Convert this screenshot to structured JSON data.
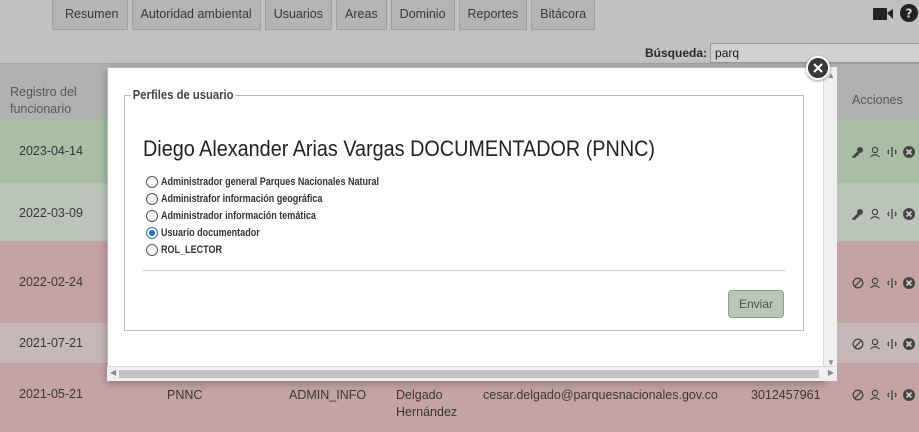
{
  "nav": {
    "tabs": [
      "Resumen",
      "Autoridad ambiental",
      "Usuarios",
      "Areas",
      "Dominio",
      "Reportes",
      "Bitácora"
    ]
  },
  "search": {
    "label": "Búsqueda:",
    "value": "parq"
  },
  "table": {
    "header_left": "Registro del funcionario",
    "header_right": "Acciones",
    "rows": [
      {
        "date": "2023-04-14"
      },
      {
        "date": "2022-03-09"
      },
      {
        "date": "2022-02-24"
      },
      {
        "date": "2021-07-21"
      },
      {
        "date": "2021-05-21",
        "entity": "PNNC",
        "role": "ADMIN_INFO",
        "surname": "Delgado Hernández",
        "email": "cesar.delgado@parquesnacionales.gov.co",
        "phone": "3012457961"
      }
    ]
  },
  "modal": {
    "legend": "Perfiles de usuario",
    "user_name": "Diego Alexander Arias Vargas DOCUMENTADOR (PNNC)",
    "roles": [
      {
        "label": "Administrador general Parques Nacionales Natural",
        "checked": false
      },
      {
        "label": "Administrafor información geográfica",
        "checked": false
      },
      {
        "label": "Administrador información temática",
        "checked": false
      },
      {
        "label": "Usuario documentador",
        "checked": true
      },
      {
        "label": "ROL_LECTOR",
        "checked": false
      }
    ],
    "submit_label": "Enviar"
  },
  "icons": {
    "top": [
      "camera-icon",
      "help-icon"
    ],
    "row_actions_active": [
      "key-icon",
      "user-icon",
      "link-icon",
      "close-circle-icon"
    ],
    "row_actions_inactive": [
      "ban-icon",
      "user-icon",
      "link-icon",
      "close-circle-icon"
    ],
    "modal_close": "close-icon"
  },
  "colors": {
    "row_green": "#cde9c9",
    "row_light_green": "#e4f0e2",
    "row_red": "#eec7c9",
    "row_light_red": "#f2e0e1",
    "radio_selected": "#1f6fd6",
    "button": "#b9c7b6"
  }
}
